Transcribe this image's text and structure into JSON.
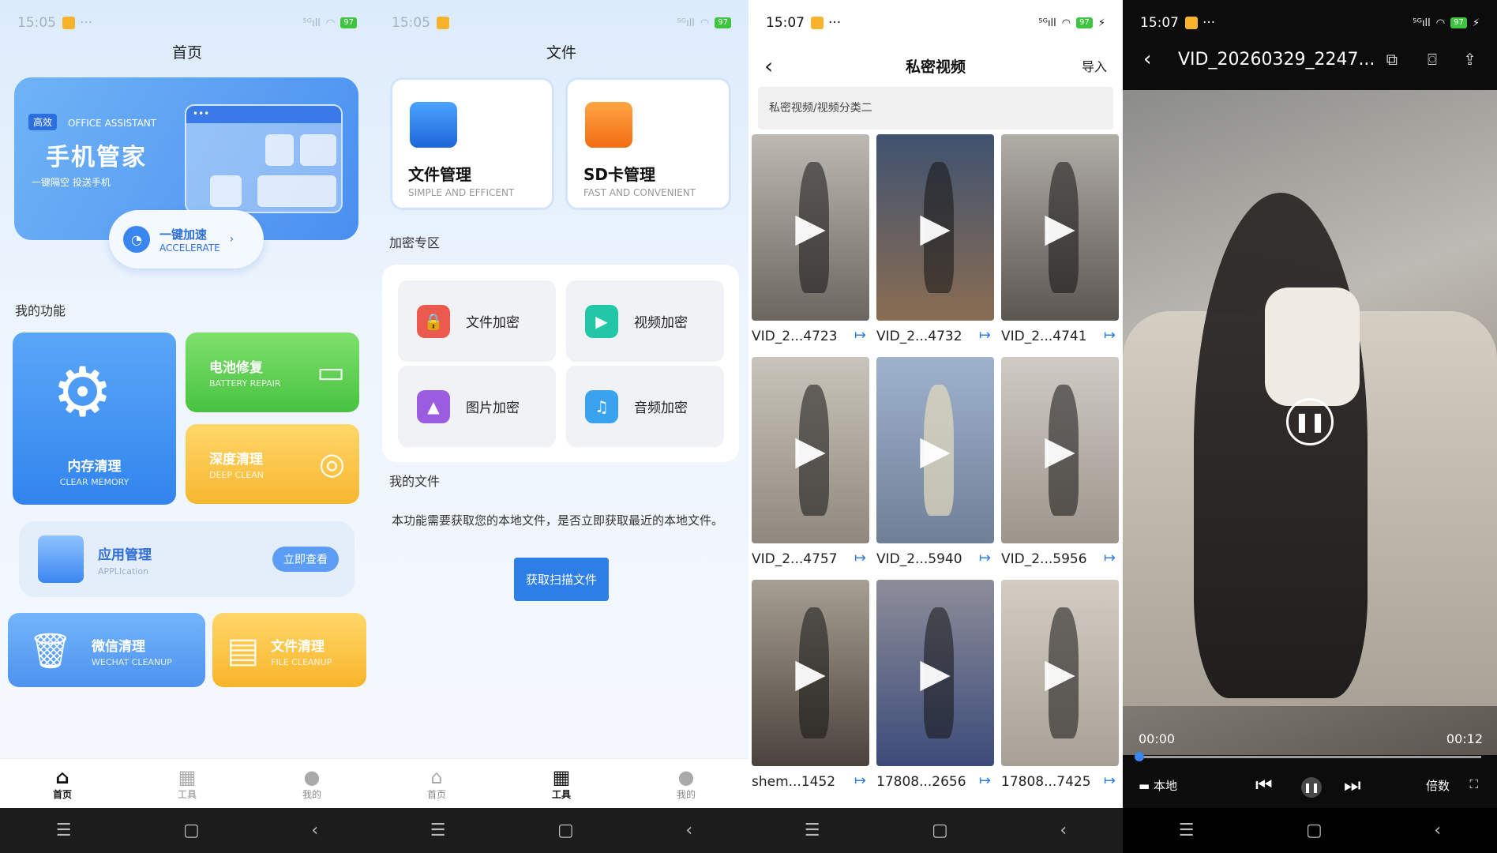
{
  "status": {
    "time1": "15:05",
    "time2": "15:05",
    "time3": "15:07",
    "time4": "15:07",
    "dots": "···",
    "signal": "⁵ᴳıll",
    "wifi": "◠",
    "battery": "97",
    "charge": "⚡"
  },
  "navbar": {
    "menu": "☰",
    "home": "▢",
    "back": "‹"
  },
  "tabs": [
    {
      "label": "首页",
      "icon": "⌂"
    },
    {
      "label": "工具",
      "icon": "▦"
    },
    {
      "label": "我的",
      "icon": "●"
    }
  ],
  "home": {
    "title": "首页",
    "banner": {
      "badge": "高效",
      "en": "OFFICE ASSISTANT",
      "big": "手机管家",
      "sub": "一键隔空  投送手机"
    },
    "accelerate": {
      "label": "一键加速",
      "en": "ACCELERATE",
      "arrow": "›"
    },
    "section": "我的功能",
    "cards": {
      "memory": {
        "title": "内存清理",
        "en": "CLEAR MEMORY"
      },
      "battery": {
        "title": "电池修复",
        "en": "BATTERY REPAIR"
      },
      "deep": {
        "title": "深度清理",
        "en": "DEEP CLEAN"
      },
      "app": {
        "title": "应用管理",
        "en": "APPLIcation",
        "button": "立即查看"
      },
      "wechat": {
        "title": "微信清理",
        "en": "WECHAT CLEANUP"
      },
      "file": {
        "title": "文件清理",
        "en": "FILE CLEANUP"
      }
    }
  },
  "files": {
    "title": "文件",
    "folder1": {
      "title": "文件管理",
      "en": "SIMPLE AND EFFICENT"
    },
    "folder2": {
      "title": "SD卡管理",
      "en": "FAST AND CONVENIENT"
    },
    "enc_section": "加密专区",
    "enc": [
      {
        "label": "文件加密",
        "icon": "🔒"
      },
      {
        "label": "视频加密",
        "icon": "▶"
      },
      {
        "label": "图片加密",
        "icon": "▲"
      },
      {
        "label": "音频加密",
        "icon": "♫"
      }
    ],
    "myfiles": "我的文件",
    "desc": "本功能需要获取您的本地文件，是否立即获取最近的本地文件。",
    "scan_button": "获取扫描文件"
  },
  "private": {
    "back": "‹",
    "title": "私密视频",
    "import": "导入",
    "breadcrumb": "私密视频/视频分类二",
    "items": [
      {
        "name": "VID_2...4723"
      },
      {
        "name": "VID_2...4732"
      },
      {
        "name": "VID_2...4741"
      },
      {
        "name": "VID_2...4757"
      },
      {
        "name": "VID_2...5940"
      },
      {
        "name": "VID_2...5956"
      },
      {
        "name": "shem...1452"
      },
      {
        "name": "17808...2656"
      },
      {
        "name": "17808...7425"
      }
    ],
    "play_icon": "▶",
    "share_icon": "↦"
  },
  "player": {
    "back": "‹",
    "title": "VID_20260329_2247...",
    "current": "00:00",
    "duration": "00:12",
    "progress": 0.0,
    "local": "本地",
    "speed": "倍数",
    "pause_icon": "❚❚",
    "prev_icon": "⏮",
    "next_icon": "⏭",
    "full_icon": "⛶",
    "pip_icon": "⧉",
    "camera_icon": "⌼",
    "share_icon": "⇪",
    "folder_icon": "▬"
  }
}
